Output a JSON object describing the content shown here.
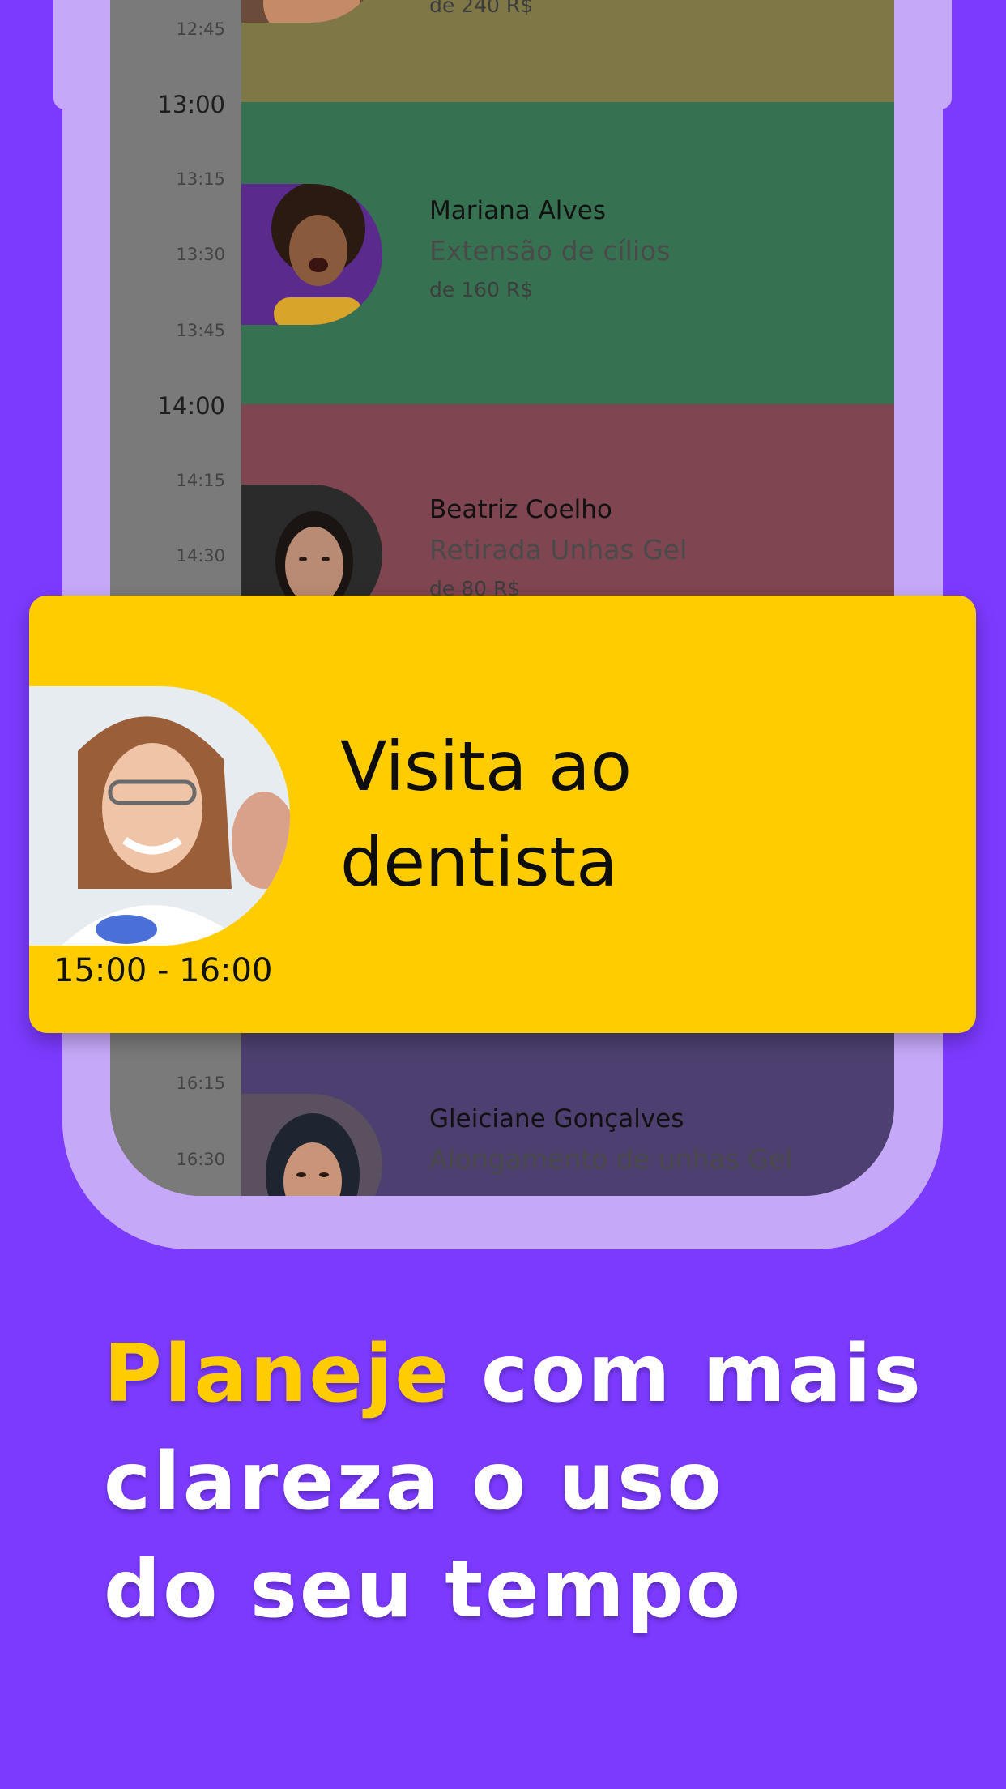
{
  "schedule": {
    "times": [
      "12:45",
      "13:00",
      "13:15",
      "13:30",
      "13:45",
      "14:00",
      "14:15",
      "14:30",
      "16:15",
      "16:30"
    ],
    "appointments": [
      {
        "name": "",
        "service": "",
        "price": "de 240 R$",
        "color": "#7f7745"
      },
      {
        "name": "Mariana Alves",
        "service": "Extensão de cílios",
        "price": "de 160 R$",
        "color": "#367252"
      },
      {
        "name": "Beatriz Coelho",
        "service": "Retirada Unhas Gel",
        "price": "de 80 R$",
        "color": "#7f4551"
      },
      {
        "name": "Gleiciane Gonçalves",
        "service": "Alongamento de unhas Gel",
        "price": "",
        "color": "#4d4070"
      }
    ]
  },
  "highlight": {
    "title": "Visita ao dentista",
    "time": "15:00 - 16:00",
    "color": "#ffcc00"
  },
  "headline": {
    "accent": "Planeje",
    "line1_rest": " com mais",
    "line2": "clareza o uso",
    "line3": "do seu tempo"
  },
  "colors": {
    "background": "#7c3aff",
    "frame": "#c6a8f8",
    "accent": "#ffcc00"
  }
}
